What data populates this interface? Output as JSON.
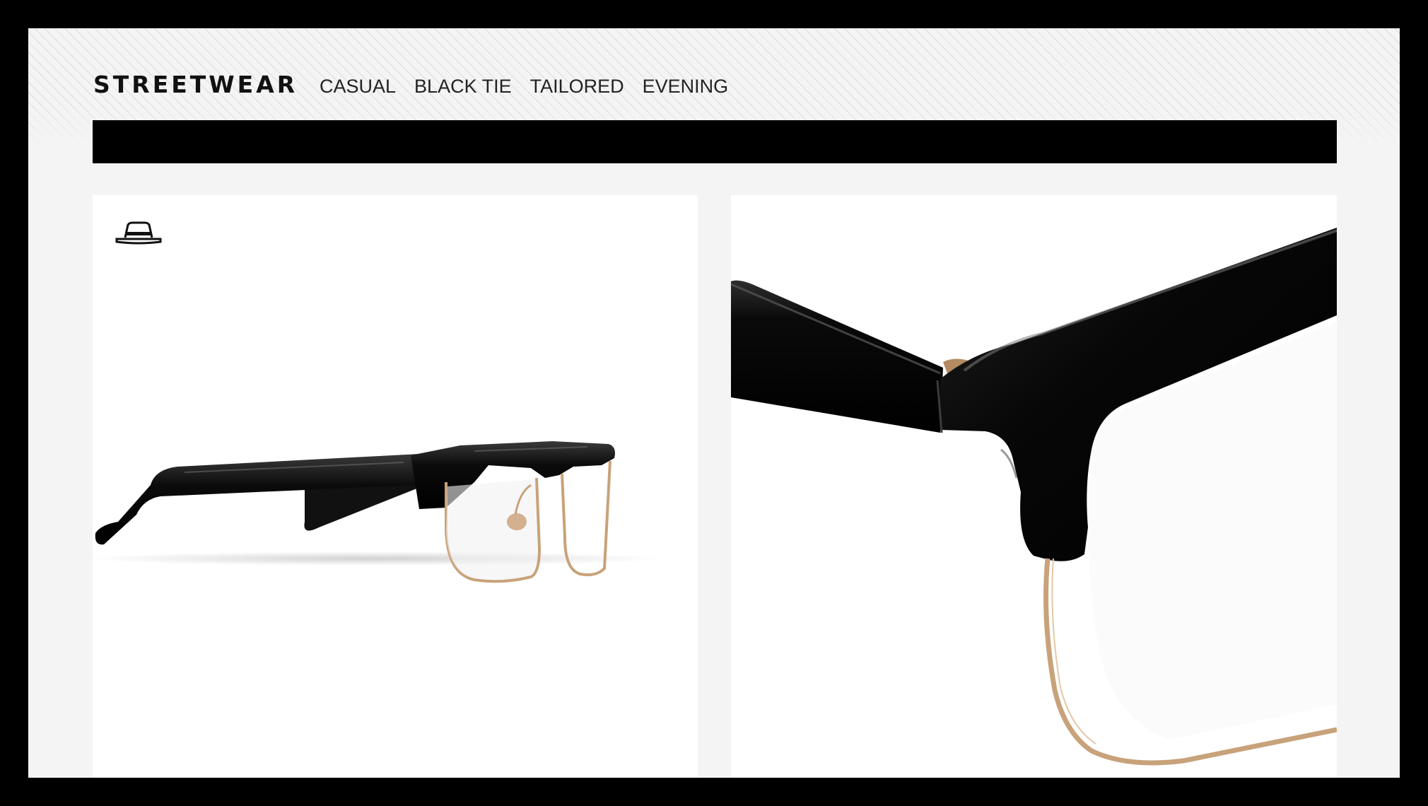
{
  "header": {
    "brand": "STREETWEAR",
    "nav": [
      {
        "label": "CASUAL"
      },
      {
        "label": "BLACK TIE"
      },
      {
        "label": "TAILORED"
      },
      {
        "label": "EVENING"
      }
    ]
  },
  "cards": [
    {
      "icon": "hat-icon",
      "image": "glasses-side-view"
    },
    {
      "image": "glasses-hinge-closeup"
    }
  ],
  "colors": {
    "frame": "#000000",
    "page_background": "#f4f4f4",
    "card_background": "#ffffff",
    "acetate": "#0c0c0c",
    "gold_rim": "#c8a27a"
  }
}
